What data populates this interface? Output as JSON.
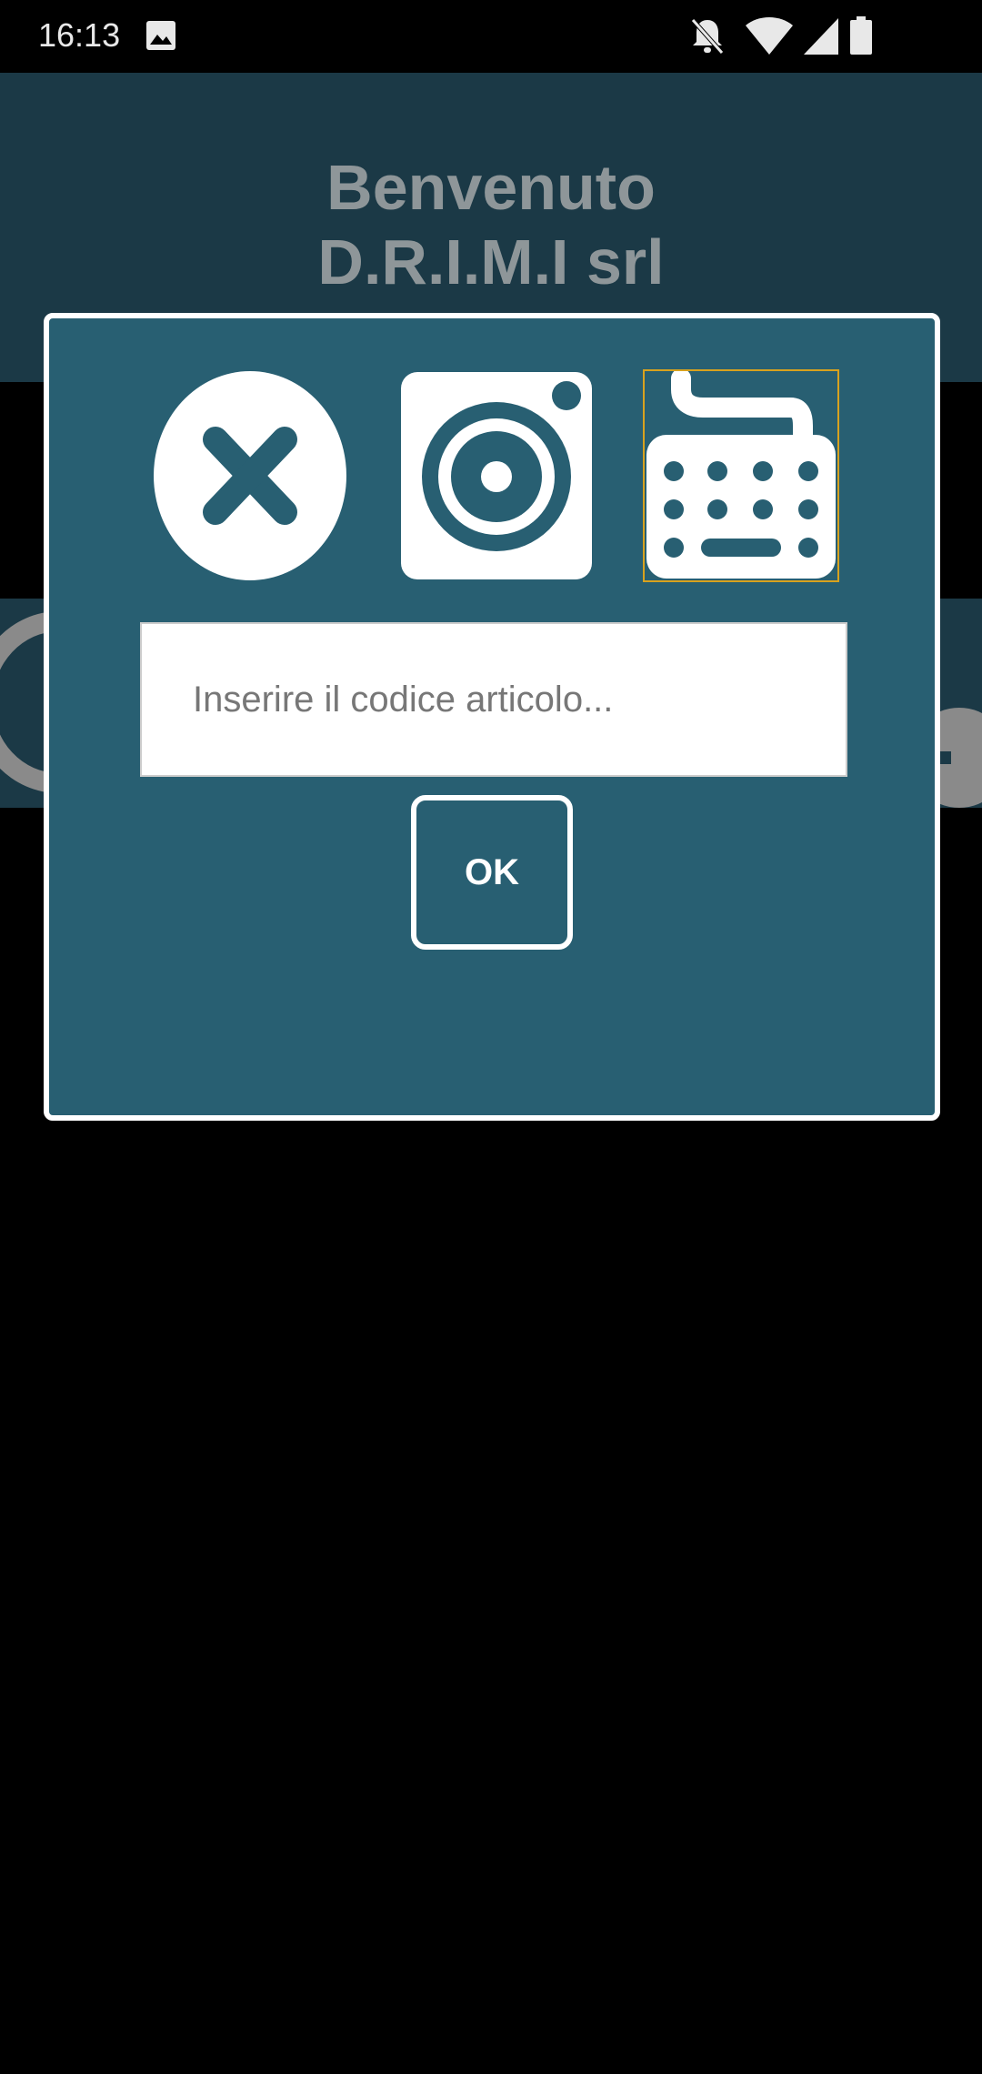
{
  "status_bar": {
    "time": "16:13",
    "icons": [
      "gallery-icon",
      "do-not-disturb-icon",
      "wifi-icon",
      "cell-signal-icon",
      "battery-icon"
    ]
  },
  "header": {
    "welcome": "Benvenuto",
    "company": "D.R.I.M.I srl"
  },
  "dialog": {
    "buttons": {
      "close_icon": "close-icon",
      "camera_icon": "camera-icon",
      "keyboard_icon": "keyboard-icon"
    },
    "code_input": {
      "value": "",
      "placeholder": "Inserire il codice articolo..."
    },
    "ok_label": "OK"
  },
  "colors": {
    "dialog_bg": "#285f72",
    "header_bg": "#1b3946",
    "keyboard_focus": "#d8a21e"
  }
}
